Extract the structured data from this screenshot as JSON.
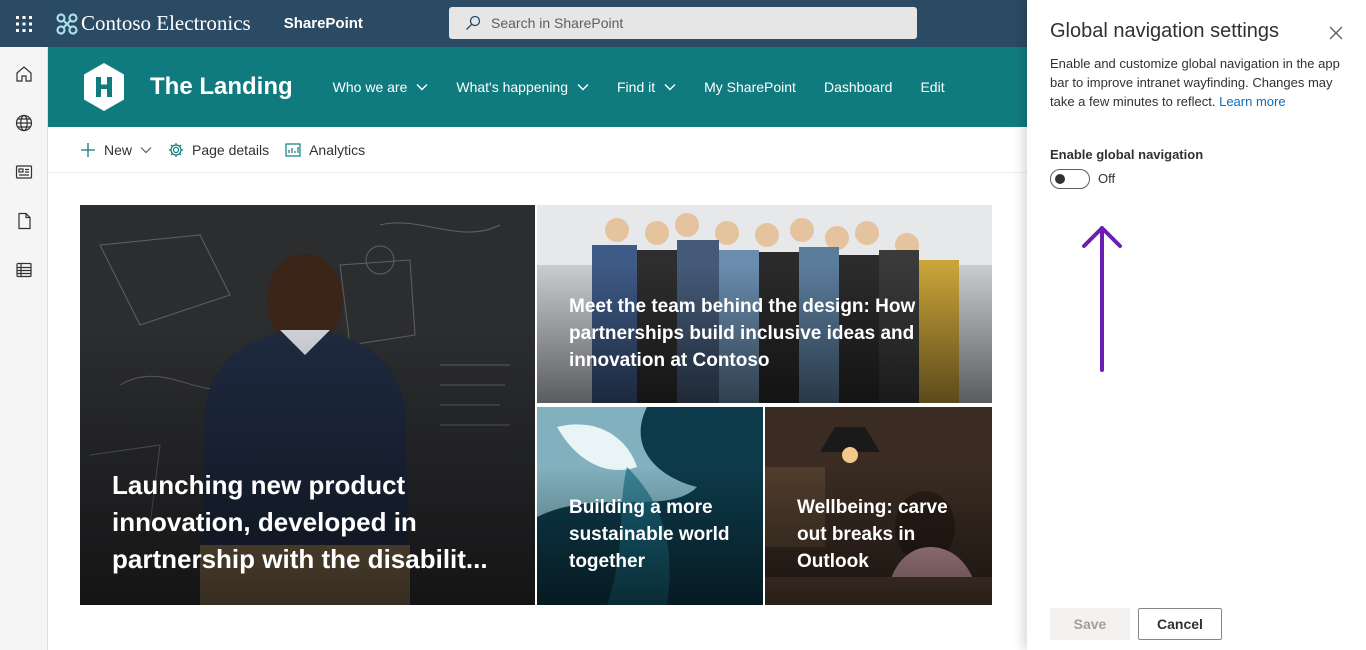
{
  "topbar": {
    "brand_name": "Contoso Electronics",
    "app_name": "SharePoint",
    "search_placeholder": "Search in SharePoint"
  },
  "rail": {
    "icons": [
      "home-icon",
      "globe-icon",
      "news-icon",
      "document-icon",
      "list-icon"
    ]
  },
  "site": {
    "title": "The Landing",
    "logo_letter": "H",
    "nav": [
      {
        "label": "Who we are",
        "has_dropdown": true
      },
      {
        "label": "What's happening",
        "has_dropdown": true
      },
      {
        "label": "Find it",
        "has_dropdown": true
      },
      {
        "label": "My SharePoint",
        "has_dropdown": false
      },
      {
        "label": "Dashboard",
        "has_dropdown": false
      },
      {
        "label": "Edit",
        "has_dropdown": false
      }
    ]
  },
  "commandbar": {
    "new_label": "New",
    "page_details_label": "Page details",
    "analytics_label": "Analytics"
  },
  "hero": {
    "tiles": [
      {
        "title": "Launching new product innovation, developed in partnership with the disabilit..."
      },
      {
        "title": "Meet the team behind the design: How partnerships build inclusive ideas and innovation at Contoso"
      },
      {
        "title": "Building a more sustainable world together"
      },
      {
        "title": "Wellbeing: carve out breaks in Outlook"
      }
    ]
  },
  "panel": {
    "title": "Global navigation settings",
    "description": "Enable and customize global navigation in the app bar to improve intranet wayfinding. Changes may take a few minutes to reflect.",
    "learn_more": "Learn more",
    "toggle_label": "Enable global navigation",
    "toggle_state": "Off",
    "save_label": "Save",
    "cancel_label": "Cancel"
  },
  "colors": {
    "topbar": "#2b4a63",
    "site_header": "#0f7b7e",
    "annotation_arrow": "#6b1fb1",
    "link": "#0f6cbd"
  }
}
